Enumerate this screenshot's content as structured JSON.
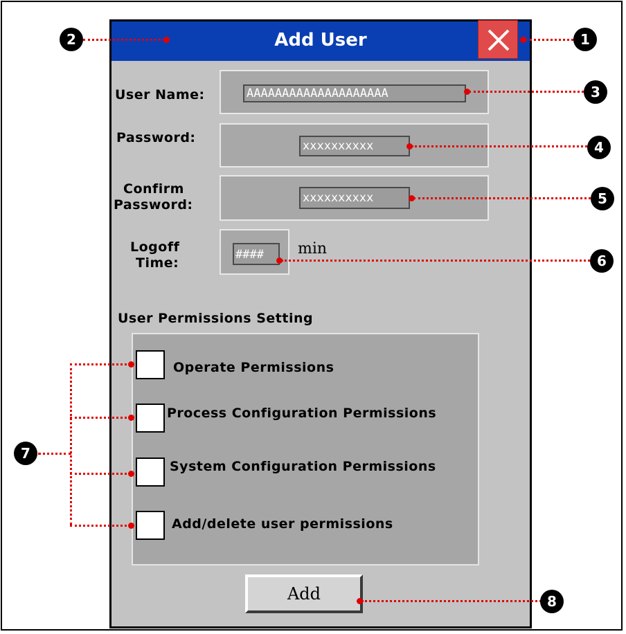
{
  "dialog": {
    "title": "Add User",
    "close_icon": "close-x-icon"
  },
  "fields": {
    "user_name_label": "User Name:",
    "user_name_value": "AAAAAAAAAAAAAAAAAAAA",
    "password_label": "Password:",
    "password_value": "xxxxxxxxxx",
    "confirm_label_line1": "Confirm",
    "confirm_label_line2": "Password:",
    "confirm_value": "xxxxxxxxxx",
    "logoff_label_line1": "Logoff",
    "logoff_label_line2": "Time:",
    "logoff_value": "####",
    "logoff_unit": "min"
  },
  "permissions": {
    "heading": "User Permissions Setting",
    "items": [
      {
        "label": "Operate Permissions"
      },
      {
        "label": "Process Configuration Permissions"
      },
      {
        "label": "System Configuration Permissions"
      },
      {
        "label": "Add/delete user permissions"
      }
    ]
  },
  "actions": {
    "add_label": "Add"
  },
  "callouts": [
    "1",
    "2",
    "3",
    "4",
    "5",
    "6",
    "7",
    "8"
  ],
  "colors": {
    "titlebar": "#0a3fb3",
    "dialog_bg": "#c3c3c3",
    "close_button": "#e04a4a",
    "leader_lines": "#e00000"
  }
}
